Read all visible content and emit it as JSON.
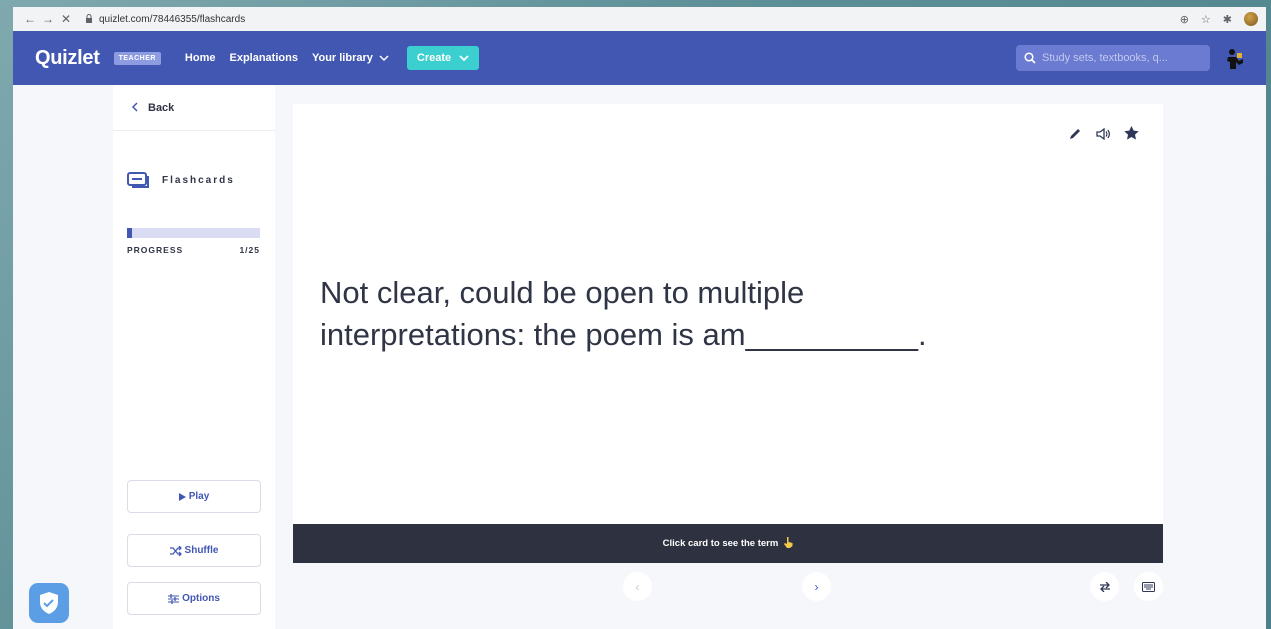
{
  "browser": {
    "url": "quizlet.com/78446355/flashcards",
    "back": "←",
    "forward": "→",
    "stop": "✕",
    "lock": "🔒",
    "zoom": "⊕",
    "star": "☆",
    "puzzle": "✱"
  },
  "header": {
    "logo": "Quizlet",
    "badge": "TEACHER",
    "nav": [
      "Home",
      "Explanations",
      "Your library"
    ],
    "create_label": "Create",
    "search_placeholder": "Study sets, textbooks, q...",
    "colors": {
      "brand": "#4257b2",
      "create": "#3ccfcf"
    }
  },
  "sidebar": {
    "back_label": "Back",
    "mode_label": "Flashcards",
    "progress": {
      "label": "PROGRESS",
      "count": "1/25",
      "fraction": 0.04
    },
    "buttons": {
      "play": "Play",
      "shuffle": "Shuffle",
      "options": "Options"
    }
  },
  "card": {
    "text": "Not clear, could be open to multiple interpretations: the poem is am__________.",
    "footer": "Click card to see the term",
    "icons": [
      "pencil-icon",
      "speaker-icon",
      "star-icon"
    ]
  },
  "controls": {
    "prev": "‹",
    "next": "›"
  }
}
